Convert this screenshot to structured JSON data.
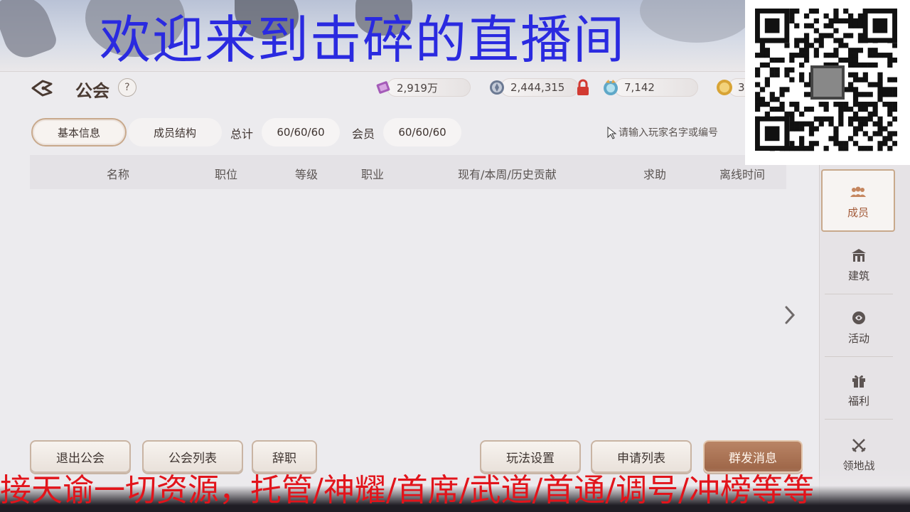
{
  "overlay": {
    "title": "欢迎来到击碎的直播间",
    "caption": "接天谕一切资源，托管/神耀/首席/武道/首通/调号/冲榜等等"
  },
  "header": {
    "title": "公会",
    "help": "?",
    "resources": [
      {
        "icon": "purple-ticket-icon",
        "value": "2,919万"
      },
      {
        "icon": "silver-coin-icon",
        "value": "2,444,315"
      },
      {
        "icon": "blue-orb-icon",
        "value": "7,142"
      },
      {
        "icon": "gold-coin-icon",
        "value": "3"
      }
    ]
  },
  "tabs": [
    {
      "label": "基本信息",
      "active": true
    },
    {
      "label": "成员结构",
      "active": false
    }
  ],
  "stats": {
    "total_label": "总计",
    "total_value": "60/60/60",
    "member_label": "会员",
    "member_value": "60/60/60"
  },
  "search": {
    "placeholder": "请输入玩家名字或编号"
  },
  "table": {
    "columns": [
      "名称",
      "职位",
      "等级",
      "职业",
      "现有/本周/历史贡献",
      "求助",
      "离线时间"
    ],
    "rows": []
  },
  "buttons": {
    "leave": "退出公会",
    "guild_list": "公会列表",
    "resign": "辞职",
    "play_settings": "玩法设置",
    "apply_list": "申请列表",
    "broadcast": "群发消息"
  },
  "sidenav": [
    {
      "label": "成员",
      "icon": "members-icon",
      "active": true
    },
    {
      "label": "建筑",
      "icon": "building-icon",
      "active": false
    },
    {
      "label": "活动",
      "icon": "activity-icon",
      "active": false
    },
    {
      "label": "福利",
      "icon": "gift-icon",
      "active": false
    },
    {
      "label": "领地战",
      "icon": "crossed-swords-icon",
      "active": false
    }
  ],
  "colors": {
    "accent_border": "#c8a98c",
    "primary_button": "#a86e4f",
    "overlay_title": "#2a2ae0",
    "caption_text": "#e2141b"
  }
}
